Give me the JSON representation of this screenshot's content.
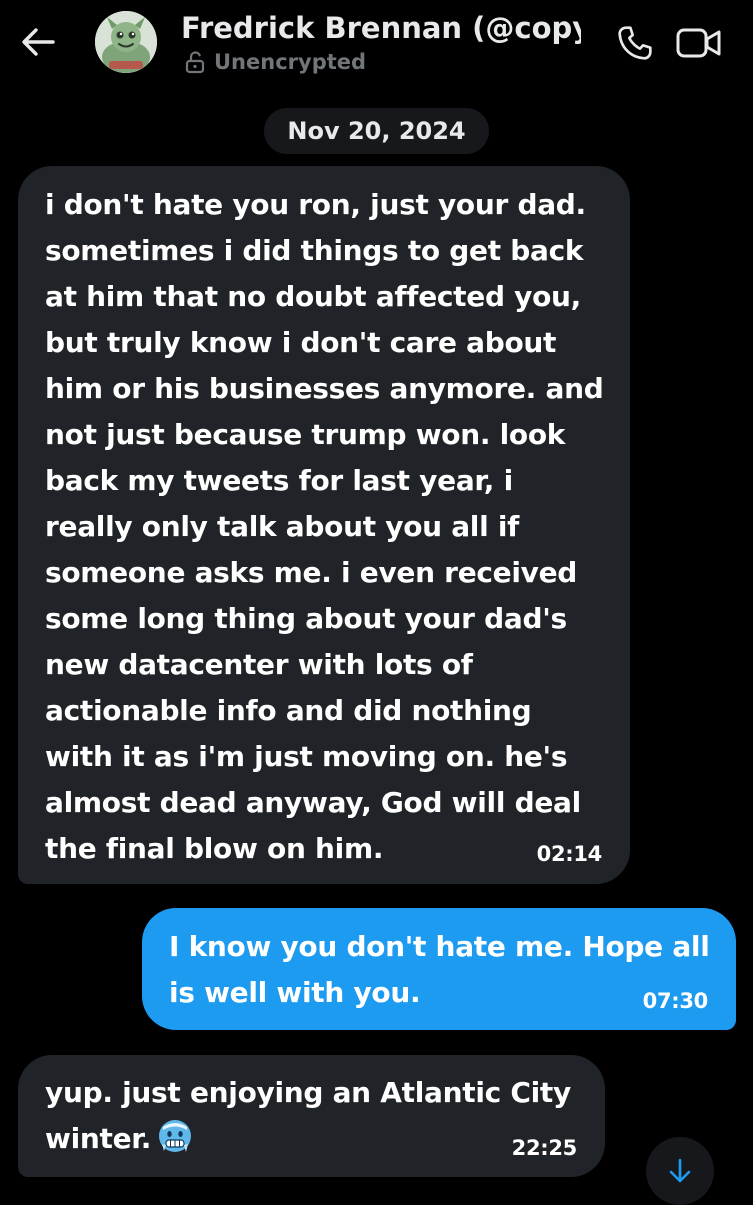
{
  "header": {
    "title": "Fredrick Brennan (@copy...",
    "subtitle": "Unencrypted",
    "avatar_icon": "avatar-image",
    "back_icon": "arrow-left-icon",
    "call_icon": "phone-icon",
    "video_icon": "video-camera-icon"
  },
  "conversation": {
    "date_separator": "Nov 20, 2024",
    "messages": [
      {
        "direction": "incoming",
        "text": "i don't hate you ron, just your dad.\nsometimes i did things to get back\nat him that no doubt affected you,\nbut truly know i don't care about\nhim or his businesses anymore. and\nnot just because trump won. look\nback my tweets for last year, i\nreally only talk about you all if\nsomeone asks me. i even received\nsome long thing about your dad's\nnew datacenter with lots of\nactionable info and did nothing\nwith it as i'm just moving on. he's\nalmost dead anyway, God will deal\nthe final blow on him.",
        "time": "02:14"
      },
      {
        "direction": "outgoing",
        "text": "I know you don't hate me. Hope all\nis well with you.",
        "time": "07:30"
      },
      {
        "direction": "incoming",
        "text_line1": "yup. just enjoying an Atlantic City",
        "text_line2": "winter.",
        "emoji": "cold-face-emoji",
        "time": "22:25"
      }
    ]
  },
  "scroll_button": {
    "icon": "arrow-down-icon"
  },
  "colors": {
    "background": "#000000",
    "incoming_bubble": "#202327",
    "outgoing_bubble": "#1d9bf0",
    "muted_text": "#71767b",
    "accent": "#1d9bf0"
  }
}
